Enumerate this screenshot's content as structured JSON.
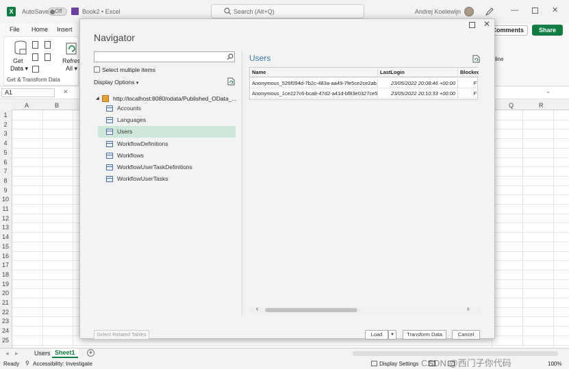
{
  "titlebar": {
    "logo": "X",
    "autosave_label": "AutoSave",
    "autosave_state": "Off",
    "doc_title": "Book2 • Excel",
    "search_placeholder": "Search (Alt+Q)",
    "user_name": "Andrej Koelewijn",
    "icons": [
      "save-icon",
      "search-icon",
      "pen-icon",
      "minimize-icon",
      "maximize-icon",
      "close-icon"
    ]
  },
  "ribbon": {
    "menu": [
      "File",
      "Home",
      "Insert"
    ],
    "get_data_line1": "Get",
    "get_data_line2": "Data",
    "refresh_line1": "Refresh",
    "refresh_line2": "All",
    "group_label": "Get & Transform Data",
    "comments": "Comments",
    "share": "Share",
    "right_partial": "line"
  },
  "formulabar": {
    "name_box": "A1"
  },
  "grid": {
    "columns_left": [
      "A",
      "B"
    ],
    "columns_right": [
      "Q",
      "R"
    ],
    "rows": [
      "1",
      "2",
      "3",
      "4",
      "5",
      "6",
      "7",
      "8",
      "9",
      "10",
      "11",
      "12",
      "13",
      "14",
      "15",
      "16",
      "17",
      "18",
      "19",
      "20",
      "21",
      "22",
      "23",
      "24",
      "25"
    ]
  },
  "sheets": {
    "tabs": [
      "Users",
      "Sheet1"
    ],
    "active": "Sheet1",
    "add": "+"
  },
  "status": {
    "ready": "Ready",
    "accessibility": "Accessibility: Investigate",
    "display_settings": "Display Settings",
    "zoom": "100%",
    "watermark": "CSDN @西门子你代码"
  },
  "navigator": {
    "title": "Navigator",
    "search_placeholder": "",
    "select_multiple": "Select multiple items",
    "display_options": "Display Options",
    "root": "http://localhost:8080/odata/Published_OData_...",
    "items": [
      {
        "label": "Accounts",
        "selected": false
      },
      {
        "label": "Languages",
        "selected": false
      },
      {
        "label": "Users",
        "selected": true
      },
      {
        "label": "WorkflowDefinitions",
        "selected": false
      },
      {
        "label": "Workflows",
        "selected": false
      },
      {
        "label": "WorkflowUserTaskDefinitions",
        "selected": false
      },
      {
        "label": "WorkflowUserTasks",
        "selected": false
      }
    ],
    "preview": {
      "title": "Users",
      "headers": [
        "Name",
        "LastLogin",
        "Blocked"
      ],
      "rows": [
        [
          "Anonymous_526f094d-7b2c-483a-aa49-7fe5ce2ce2ab",
          "23/05/2022 20:08:46 +00:00",
          "F"
        ],
        [
          "Anonymous_1ce227c6-bca8-47d2-a41d-bf83e0327ce5",
          "23/05/2022 20:10:33 +00:00",
          "F"
        ]
      ]
    },
    "buttons": {
      "select_related": "Select Related Tables",
      "load": "Load",
      "transform": "Transform Data",
      "cancel": "Cancel"
    }
  }
}
